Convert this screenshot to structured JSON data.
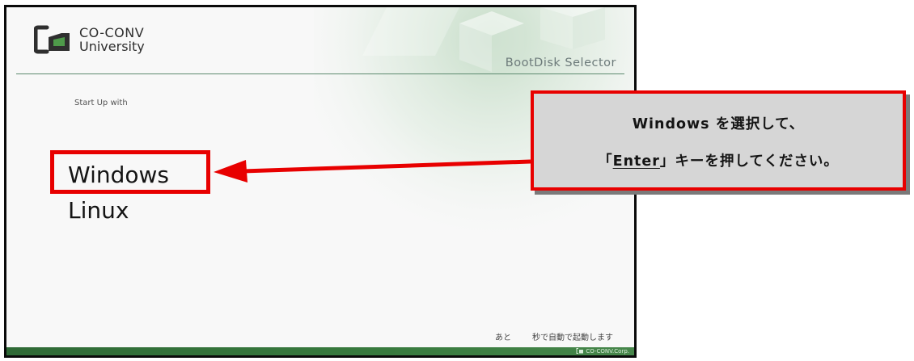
{
  "boot_screen": {
    "brand": {
      "line1": "CO-CONV",
      "line2": "University"
    },
    "title": "BootDisk Selector",
    "startup_label": "Start Up with",
    "menu": {
      "items": [
        {
          "label": "Windows",
          "selected": true
        },
        {
          "label": "Linux",
          "selected": false
        }
      ]
    },
    "countdown": {
      "prefix": "あと",
      "suffix": "秒で自動で起動します"
    },
    "footer_brand": "CO-CONV.Corp."
  },
  "annotation": {
    "line1": "Windows を選択して、",
    "line2_open": "「",
    "line2_key": "Enter",
    "line2_rest": "」キーを押してください。"
  },
  "colors": {
    "highlight": "#e80000",
    "callout_bg": "#d6d6d6",
    "footer_green": "#387a3e",
    "header_rule": "#5d8a6f"
  },
  "icons": {
    "logo": "co-conv-logo-icon",
    "footer_logo": "co-conv-small-logo-icon",
    "arrow": "left-arrow-icon"
  }
}
